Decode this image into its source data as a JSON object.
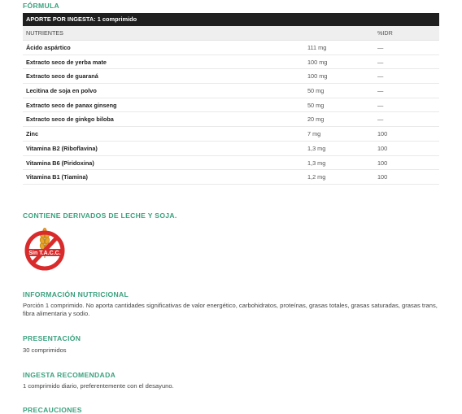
{
  "formula_title": "FÓRMULA",
  "table": {
    "header": "APORTE POR INGESTA: 1 comprimido",
    "col_nutrients": "NUTRIENTES",
    "col_amount": "",
    "col_idr": "%IDR",
    "rows": [
      {
        "name": "Ácido aspártico",
        "amount": "111 mg",
        "idr": "—"
      },
      {
        "name": "Extracto seco de yerba mate",
        "amount": "100 mg",
        "idr": "—"
      },
      {
        "name": "Extracto seco de guaraná",
        "amount": "100 mg",
        "idr": "—"
      },
      {
        "name": "Lecitina de soja en polvo",
        "amount": "50 mg",
        "idr": "—"
      },
      {
        "name": "Extracto seco de panax ginseng",
        "amount": "50 mg",
        "idr": "—"
      },
      {
        "name": "Extracto seco de ginkgo biloba",
        "amount": "20 mg",
        "idr": "—"
      },
      {
        "name": "Zinc",
        "amount": "7 mg",
        "idr": "100"
      },
      {
        "name": "Vitamina B2 (Riboflavina)",
        "amount": "1,3 mg",
        "idr": "100"
      },
      {
        "name": "Vitamina B6 (Piridoxina)",
        "amount": "1,3 mg",
        "idr": "100"
      },
      {
        "name": "Vitamina B1 (Tiamina)",
        "amount": "1,2 mg",
        "idr": "100"
      }
    ]
  },
  "allergen_title": "CONTIENE DERIVADOS DE LECHE Y SOJA.",
  "badge_text": "Sin T.A.C.C.",
  "info": {
    "title": "INFORMACIÓN NUTRICIONAL",
    "text": "Porción 1 comprimido. No aporta cantidades significativas de valor energético, carbohidratos, proteínas, grasas totales, grasas saturadas, grasas trans, fibra alimentaria y sodio."
  },
  "presentation": {
    "title": "PRESENTACIÓN",
    "text": "30 comprimidos"
  },
  "intake": {
    "title": "INGESTA RECOMENDADA",
    "text": "1 comprimido diario, preferentemente con el desayuno."
  },
  "precautions": {
    "title": "PRECAUCIONES"
  },
  "colors": {
    "accent": "#3aa17e",
    "table_header": "#1f1f1f",
    "badge_red": "#d92b2b"
  }
}
